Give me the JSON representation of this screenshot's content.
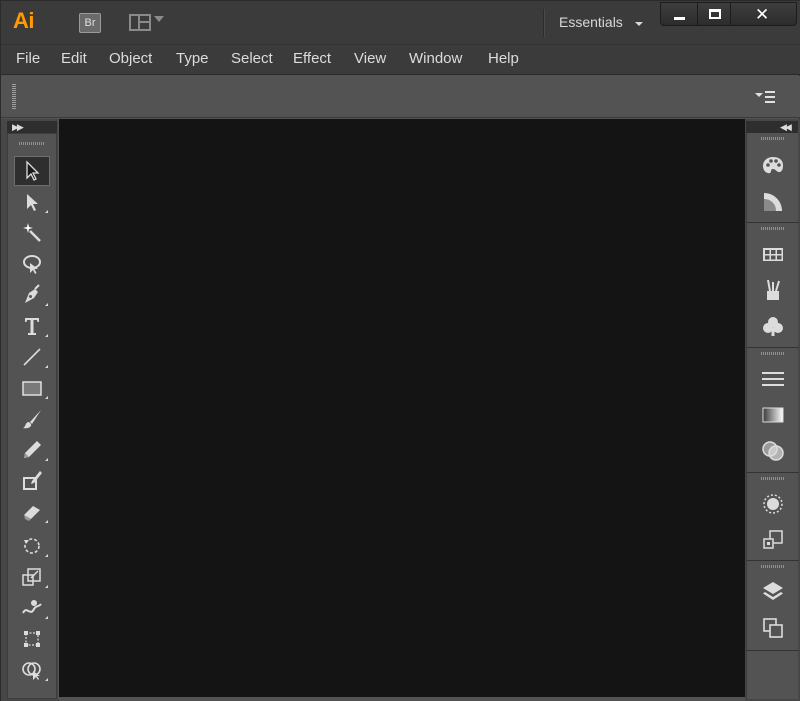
{
  "app": {
    "logo": "Ai",
    "bridge_label": "Br",
    "workspace": "Essentials",
    "window_controls": {
      "minimize": "minimize",
      "maximize": "maximize",
      "close": "✕"
    }
  },
  "menu": {
    "items": [
      "File",
      "Edit",
      "Object",
      "Type",
      "Select",
      "Effect",
      "View",
      "Window",
      "Help"
    ]
  },
  "tools": [
    {
      "name": "selection-tool",
      "icon": "selection-arrow-icon",
      "active": true
    },
    {
      "name": "direct-selection-tool",
      "icon": "direct-selection-icon"
    },
    {
      "name": "magic-wand-tool",
      "icon": "magic-wand-icon"
    },
    {
      "name": "lasso-tool",
      "icon": "lasso-icon"
    },
    {
      "name": "pen-tool",
      "icon": "pen-icon"
    },
    {
      "name": "type-tool",
      "icon": "type-icon"
    },
    {
      "name": "line-segment-tool",
      "icon": "line-icon"
    },
    {
      "name": "rectangle-tool",
      "icon": "rectangle-icon"
    },
    {
      "name": "paintbrush-tool",
      "icon": "paintbrush-icon"
    },
    {
      "name": "pencil-tool",
      "icon": "pencil-icon"
    },
    {
      "name": "blob-brush-tool",
      "icon": "blob-brush-icon"
    },
    {
      "name": "eraser-tool",
      "icon": "eraser-icon"
    },
    {
      "name": "rotate-tool",
      "icon": "rotate-icon"
    },
    {
      "name": "scale-tool",
      "icon": "scale-icon"
    },
    {
      "name": "warp-tool",
      "icon": "warp-icon"
    },
    {
      "name": "free-transform-tool",
      "icon": "free-transform-icon"
    },
    {
      "name": "shape-builder-tool",
      "icon": "shape-builder-icon"
    }
  ],
  "dock_panels": [
    {
      "icons": [
        "color-palette-icon",
        "color-guide-icon"
      ]
    },
    {
      "icons": [
        "swatches-icon",
        "brushes-icon",
        "symbols-icon"
      ]
    },
    {
      "icons": [
        "stroke-icon",
        "gradient-icon",
        "transparency-icon"
      ]
    },
    {
      "icons": [
        "appearance-icon",
        "graphic-styles-icon"
      ]
    },
    {
      "icons": [
        "layers-icon",
        "artboards-icon"
      ]
    }
  ],
  "colors": {
    "accent": "#ff9a00",
    "canvas": "#141414",
    "panel": "#535353",
    "chrome": "#3b3b3b"
  }
}
